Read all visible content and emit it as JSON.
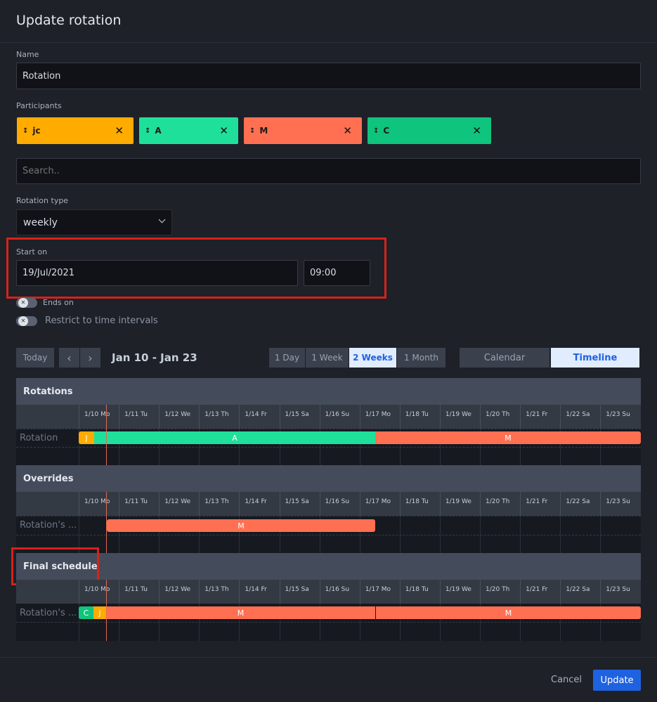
{
  "dialog": {
    "title": "Update rotation"
  },
  "name": {
    "label": "Name",
    "value": "Rotation"
  },
  "participants": {
    "label": "Participants",
    "chips": [
      {
        "text": "jc",
        "color": "#ffab00"
      },
      {
        "text": "A",
        "color": "#1fe09a"
      },
      {
        "text": "M",
        "color": "#ff7052"
      },
      {
        "text": "C",
        "color": "#0fc47c"
      }
    ],
    "search_placeholder": "Search.."
  },
  "rotation_type": {
    "label": "Rotation type",
    "value": "weekly"
  },
  "start_on": {
    "label": "Start on",
    "date": "19/Jul/2021",
    "time": "09:00"
  },
  "ends_on": {
    "label": "Ends on"
  },
  "restrict": {
    "label": "Restrict to time intervals"
  },
  "toolbar": {
    "today": "Today",
    "prev": "‹",
    "next": "›",
    "range": "Jan 10 - Jan 23",
    "views": [
      "1 Day",
      "1 Week",
      "2 Weeks",
      "1 Month"
    ],
    "active_view": "2 Weeks",
    "modes": [
      "Calendar",
      "Timeline"
    ],
    "active_mode": "Timeline"
  },
  "days": [
    "1/10 Mo",
    "1/11 Tu",
    "1/12 We",
    "1/13 Th",
    "1/14 Fr",
    "1/15 Sa",
    "1/16 Su",
    "1/17 Mo",
    "1/18 Tu",
    "1/19 We",
    "1/20 Th",
    "1/21 Fr",
    "1/22 Sa",
    "1/23 Su"
  ],
  "sections": {
    "rotations": {
      "title": "Rotations",
      "row_label": "Rotation",
      "bars": [
        {
          "text": "J",
          "color": "#ffab00"
        },
        {
          "text": "A",
          "color": "#1fe09a"
        },
        {
          "text": "M",
          "color": "#ff7052"
        }
      ]
    },
    "overrides": {
      "title": "Overrides",
      "row_label": "Rotation's ...",
      "bars": [
        {
          "text": "M",
          "color": "#ff7052"
        }
      ]
    },
    "final": {
      "title": "Final schedule",
      "row_label": "Rotation's ...",
      "bars": [
        {
          "text": "C",
          "color": "#0fc47c"
        },
        {
          "text": "J",
          "color": "#ffab00"
        },
        {
          "text": "M",
          "color": "#ff7052"
        },
        {
          "text": "M",
          "color": "#ff7052"
        }
      ]
    }
  },
  "footer": {
    "cancel": "Cancel",
    "update": "Update"
  }
}
